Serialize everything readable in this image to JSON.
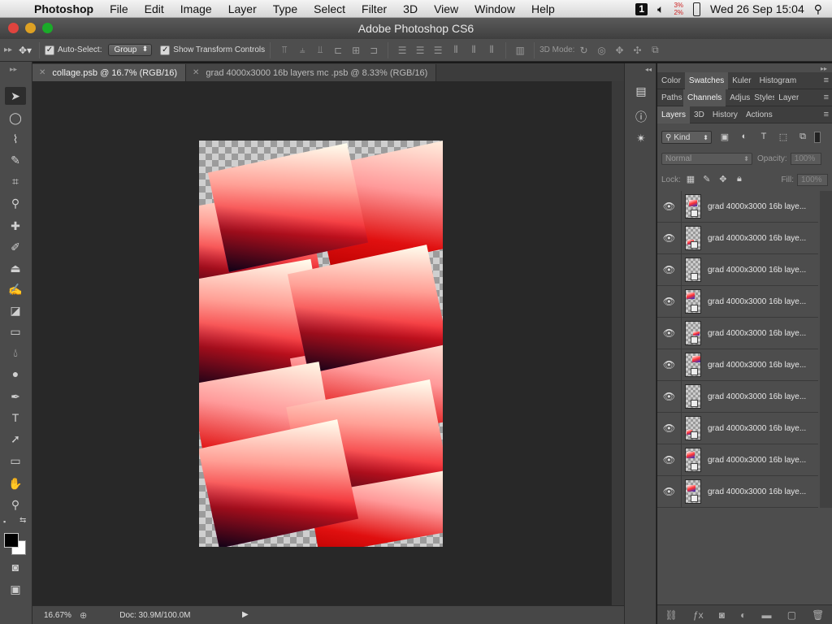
{
  "menubar": {
    "app_name": "Photoshop",
    "items": [
      "File",
      "Edit",
      "Image",
      "Layer",
      "Type",
      "Select",
      "Filter",
      "3D",
      "View",
      "Window",
      "Help"
    ],
    "badge_num": "1",
    "cpu_top": "3%",
    "cpu_bottom": "2%",
    "clock": "Wed 26 Sep  15:04"
  },
  "window": {
    "title": "Adobe Photoshop CS6"
  },
  "options": {
    "auto_select_label": "Auto-Select:",
    "auto_select_value": "Group",
    "transform_label": "Show Transform Controls",
    "mode3d_label": "3D Mode:"
  },
  "tabs": [
    {
      "label": "collage.psb @ 16.7% (RGB/16)",
      "active": true
    },
    {
      "label": "grad 4000x3000 16b layers mc .psb @ 8.33% (RGB/16)",
      "active": false
    }
  ],
  "status": {
    "zoom": "16.67%",
    "doc": "Doc: 30.9M/100.0M"
  },
  "panels": {
    "group1": [
      "Color",
      "Swatches",
      "Kuler",
      "Histogram"
    ],
    "group1_active": "Swatches",
    "group2": [
      "Paths",
      "Channels",
      "Adjustments",
      "Styles",
      "Layer Comps"
    ],
    "group2_active": "Channels",
    "group3": [
      "Layers",
      "3D",
      "History",
      "Actions"
    ],
    "group3_active": "Layers",
    "kind_label": "Kind",
    "blend_mode": "Normal",
    "opacity_label": "Opacity:",
    "opacity_value": "100%",
    "lock_label": "Lock:",
    "fill_label": "Fill:",
    "fill_value": "100%"
  },
  "layers": [
    "grad 4000x3000 16b laye...",
    "grad 4000x3000 16b laye...",
    "grad 4000x3000 16b laye...",
    "grad 4000x3000 16b laye...",
    "grad 4000x3000 16b laye...",
    "grad 4000x3000 16b laye...",
    "grad 4000x3000 16b laye...",
    "grad 4000x3000 16b laye...",
    "grad 4000x3000 16b laye...",
    "grad 4000x3000 16b laye..."
  ],
  "colors": {
    "foreground": "#000000",
    "background": "#ffffff"
  }
}
